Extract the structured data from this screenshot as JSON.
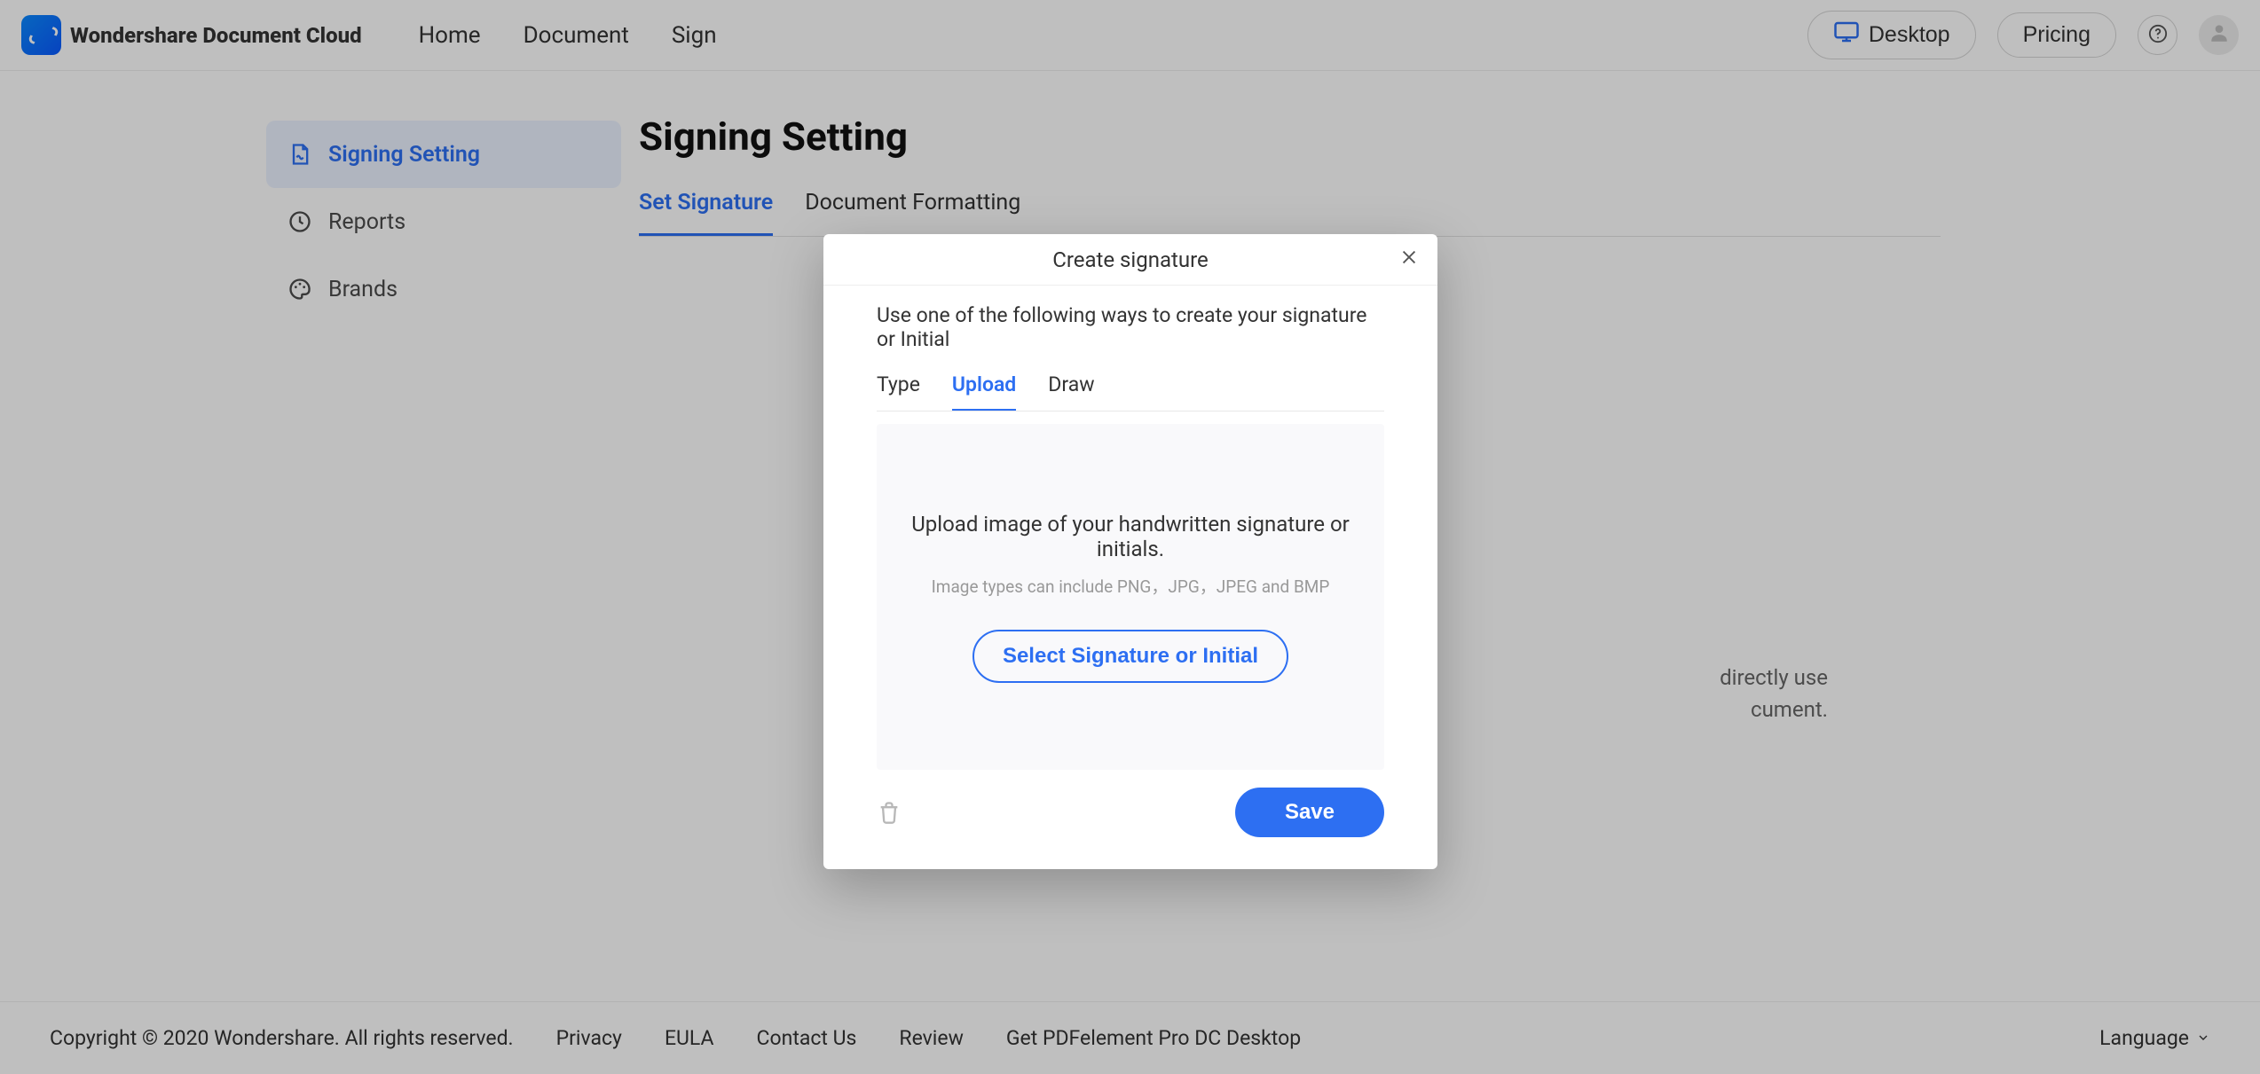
{
  "brand": "Wondershare Document Cloud",
  "nav": {
    "home": "Home",
    "document": "Document",
    "sign": "Sign"
  },
  "header_buttons": {
    "desktop": "Desktop",
    "pricing": "Pricing"
  },
  "sidebar": {
    "items": [
      {
        "label": "Signing Setting",
        "icon": "signature-file-icon",
        "active": true
      },
      {
        "label": "Reports",
        "icon": "clock-icon",
        "active": false
      },
      {
        "label": "Brands",
        "icon": "palette-icon",
        "active": false
      }
    ]
  },
  "page_title": "Signing Setting",
  "tabs": {
    "set_signature": "Set Signature",
    "doc_formatting": "Document Formatting"
  },
  "background_hint": {
    "line1_fragment": "directly use",
    "line2_fragment": "cument."
  },
  "modal": {
    "title": "Create signature",
    "description": "Use one of the following ways to create your signature or Initial",
    "tabs": {
      "type": "Type",
      "upload": "Upload",
      "draw": "Draw"
    },
    "upload": {
      "headline": "Upload image of your handwritten signature or initials.",
      "subtext": "Image types can include PNG，JPG，JPEG and BMP",
      "select_button": "Select Signature or Initial"
    },
    "save_button": "Save"
  },
  "footer": {
    "copyright": "Copyright © 2020 Wondershare. All rights reserved.",
    "links": {
      "privacy": "Privacy",
      "eula": "EULA",
      "contact": "Contact Us",
      "review": "Review",
      "getdesktop": "Get PDFelement Pro DC Desktop"
    },
    "language": "Language"
  }
}
